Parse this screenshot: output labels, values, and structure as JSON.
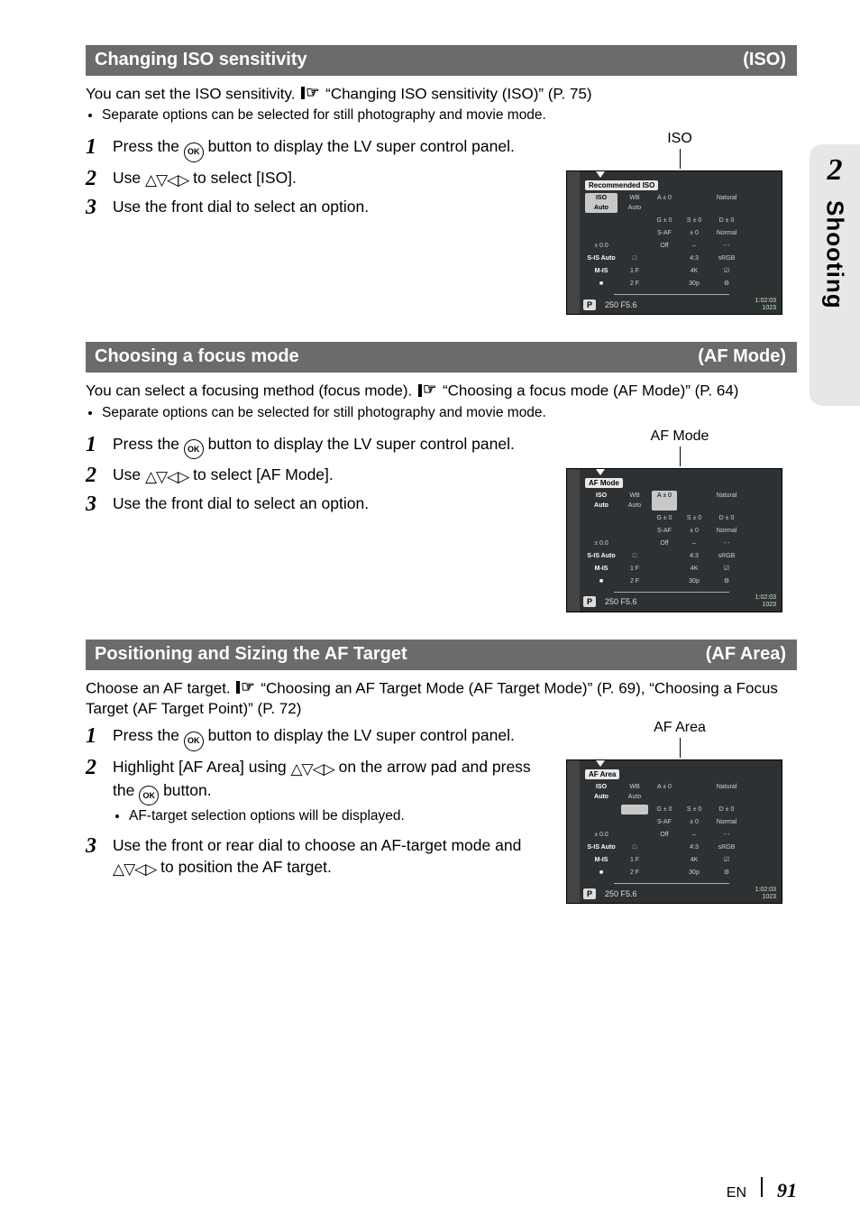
{
  "sideTab": {
    "number": "2",
    "label": "Shooting"
  },
  "sections": [
    {
      "title": "Changing ISO sensitivity",
      "tag": "(ISO)",
      "intro_pre": "You can set the ISO sensitivity. ",
      "intro_ref": "“Changing ISO sensitivity (ISO)” (P. 75)",
      "bullets": [
        "Separate options can be selected for still photography and movie mode."
      ],
      "steps": [
        {
          "n": "1",
          "pre": "Press the ",
          "mid": " button to display the LV super control panel.",
          "has_ok": true
        },
        {
          "n": "2",
          "pre": "Use ",
          "mid": " to select [ISO].",
          "has_arrows": true
        },
        {
          "n": "3",
          "pre": "Use the front dial to select an option.",
          "mid": ""
        }
      ],
      "panel": {
        "pointer_label": "ISO",
        "title_chip": "Recommended ISO",
        "hl_index": [
          0,
          0
        ]
      }
    },
    {
      "title": "Choosing a focus mode",
      "tag": "(AF Mode)",
      "intro_pre": "You can select a focusing method (focus mode). ",
      "intro_ref": "“Choosing a focus mode (AF Mode)” (P. 64)",
      "bullets": [
        "Separate options can be selected for still photography and movie mode."
      ],
      "steps": [
        {
          "n": "1",
          "pre": "Press the ",
          "mid": " button to display the LV super control panel.",
          "has_ok": true
        },
        {
          "n": "2",
          "pre": "Use ",
          "mid": " to select [AF Mode].",
          "has_arrows": true
        },
        {
          "n": "3",
          "pre": "Use the front dial to select an option.",
          "mid": ""
        }
      ],
      "panel": {
        "pointer_label": "AF Mode",
        "title_chip": "AF Mode",
        "hl_index": [
          0,
          2
        ]
      }
    },
    {
      "title": "Positioning and Sizing the AF Target",
      "tag": "(AF Area)",
      "intro_pre": "Choose an AF target. ",
      "intro_ref": "“Choosing an AF Target Mode (AF Target Mode)” (P. 69), “Choosing a Focus Target (AF Target Point)” (P. 72)",
      "bullets": [],
      "steps": [
        {
          "n": "1",
          "pre": "Press the ",
          "mid": " button to display the LV super control panel.",
          "has_ok": true
        },
        {
          "n": "2",
          "pre": "Highlight [AF Area] using ",
          "mid": " on the arrow pad and press the ",
          "has_arrows": true,
          "tail_ok": true,
          "tail": " button.",
          "sub": [
            "AF-target selection options will be displayed."
          ]
        },
        {
          "n": "3",
          "pre": "Use the front or rear dial to choose an AF-target mode and ",
          "mid": " to position the AF target.",
          "has_arrows": true
        }
      ],
      "panel": {
        "pointer_label": "AF Area",
        "title_chip": "AF Area",
        "hl_index": [
          1,
          1
        ]
      }
    }
  ],
  "lv_grid": {
    "rows": [
      [
        "ISO\nAuto",
        "WB\nAuto",
        "A ± 0",
        "",
        "Natural",
        ""
      ],
      [
        "",
        "",
        "G ± 0",
        "S ± 0",
        "D ± 0",
        ""
      ],
      [
        "",
        "",
        "S-AF",
        "± 0",
        "Normal",
        ""
      ],
      [
        "± 0.0",
        "",
        "Off",
        "–",
        "- -",
        ""
      ],
      [
        "S-IS Auto",
        "□",
        "",
        "4:3",
        "sRGB",
        ""
      ],
      [
        "M-IS",
        "1  F",
        "",
        "4K",
        "☑",
        ""
      ],
      [
        "■",
        "2  F",
        "",
        "30p",
        "⚙",
        ""
      ]
    ],
    "bottom": {
      "p": "P",
      "ev": "250   F5.6",
      "counts": "1:02:03\n1023"
    }
  },
  "footer": {
    "lang": "EN",
    "page": "91"
  }
}
